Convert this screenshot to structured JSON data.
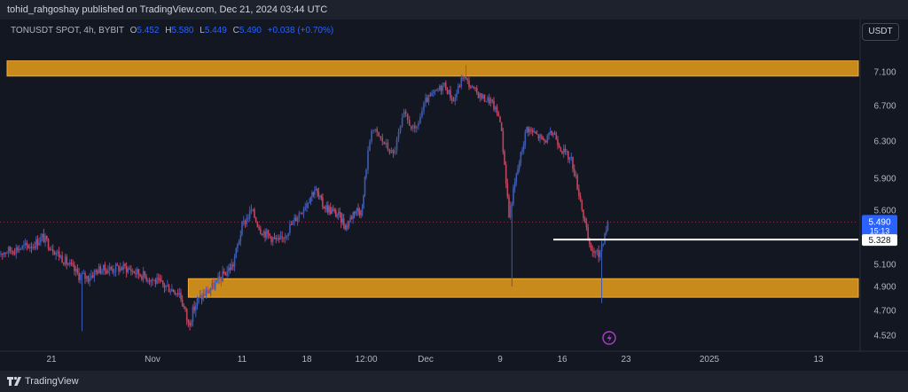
{
  "header": {
    "publisher_line": "tohid_rahgoshay published on TradingView.com, Dec 21, 2024 03:44 UTC"
  },
  "legend": {
    "symbol": "TONUSDT SPOT, 4h, BYBIT",
    "o_label": "O",
    "o_value": "5.452",
    "h_label": "H",
    "h_value": "5.580",
    "l_label": "L",
    "l_value": "5.449",
    "c_label": "C",
    "c_value": "5.490",
    "change": "+0.038 (+0.70%)"
  },
  "currency_button": "USDT",
  "footer": {
    "brand": "TradingView"
  },
  "colors": {
    "background": "#131722",
    "up_candle": "#3d5bb5",
    "down_candle": "#c2455e",
    "zone_fill": "#c98a1c",
    "price_tag": "#2962ff",
    "level_line": "#ffffff"
  },
  "chart_data": {
    "type": "candlestick",
    "symbol": "TONUSDT",
    "timeframe": "4h",
    "ylim": [
      4.45,
      7.3
    ],
    "y_ticks": [
      "7.100",
      "6.700",
      "6.300",
      "5.900",
      "5.600",
      "5.100",
      "4.900",
      "4.700",
      "4.520"
    ],
    "x_ticks": [
      "21",
      "Nov",
      "11",
      "18",
      "12:00",
      "Dec",
      "9",
      "16",
      "23",
      "2025",
      "13"
    ],
    "x_tick_dates": [
      "2024-10-21",
      "2024-11-01",
      "2024-11-11",
      "2024-11-18",
      "2024-11-25 12:00",
      "2024-12-01",
      "2024-12-09",
      "2024-12-16",
      "2024-12-23",
      "2025-01-01",
      "2025-01-13"
    ],
    "last_date": "2024-12-21",
    "current_price": {
      "value": "5.490",
      "countdown": "15:13"
    },
    "horizontal_level": {
      "value": "5.328"
    },
    "zones": [
      {
        "from": 7.05,
        "to": 7.23
      },
      {
        "from": 4.81,
        "to": 4.97
      }
    ],
    "close_path": [
      [
        "2024-10-15",
        5.2
      ],
      [
        "2024-10-17",
        5.24
      ],
      [
        "2024-10-19",
        5.28
      ],
      [
        "2024-10-20",
        5.35
      ],
      [
        "2024-10-22",
        5.17
      ],
      [
        "2024-10-24",
        5.0
      ],
      [
        "2024-10-25",
        4.98
      ],
      [
        "2024-10-26",
        5.05
      ],
      [
        "2024-10-29",
        5.07
      ],
      [
        "2024-10-31",
        5.0
      ],
      [
        "2024-11-02",
        4.92
      ],
      [
        "2024-11-04",
        4.85
      ],
      [
        "2024-11-05",
        4.6
      ],
      [
        "2024-11-06",
        4.78
      ],
      [
        "2024-11-08",
        4.92
      ],
      [
        "2024-11-10",
        5.1
      ],
      [
        "2024-11-11",
        5.45
      ],
      [
        "2024-11-12",
        5.6
      ],
      [
        "2024-11-13",
        5.42
      ],
      [
        "2024-11-15",
        5.3
      ],
      [
        "2024-11-17",
        5.55
      ],
      [
        "2024-11-19",
        5.8
      ],
      [
        "2024-11-20",
        5.65
      ],
      [
        "2024-11-22",
        5.55
      ],
      [
        "2024-11-23",
        5.45
      ],
      [
        "2024-11-24",
        5.6
      ],
      [
        "2024-11-25",
        5.6
      ],
      [
        "2024-11-26",
        6.45
      ],
      [
        "2024-11-28",
        6.15
      ],
      [
        "2024-11-29",
        6.6
      ],
      [
        "2024-11-30",
        6.4
      ],
      [
        "2024-12-01",
        6.75
      ],
      [
        "2024-12-03",
        6.95
      ],
      [
        "2024-12-04",
        6.75
      ],
      [
        "2024-12-05",
        7.05
      ],
      [
        "2024-12-06",
        6.9
      ],
      [
        "2024-12-07",
        6.8
      ],
      [
        "2024-12-08",
        6.75
      ],
      [
        "2024-12-09",
        6.55
      ],
      [
        "2024-12-10",
        5.55
      ],
      [
        "2024-12-11",
        6.0
      ],
      [
        "2024-12-12",
        6.45
      ],
      [
        "2024-12-14",
        6.3
      ],
      [
        "2024-12-15",
        6.4
      ],
      [
        "2024-12-16",
        6.2
      ],
      [
        "2024-12-17",
        6.1
      ],
      [
        "2024-12-18",
        5.7
      ],
      [
        "2024-12-19",
        5.25
      ],
      [
        "2024-12-20",
        5.18
      ],
      [
        "2024-12-21",
        5.49
      ]
    ],
    "wick_events": [
      {
        "date": "2024-10-24",
        "low": 4.55
      },
      {
        "date": "2024-11-05",
        "low": 4.58
      },
      {
        "date": "2024-12-05",
        "high": 7.18
      },
      {
        "date": "2024-12-10",
        "low": 4.9
      },
      {
        "date": "2024-12-20",
        "low": 4.76
      }
    ]
  }
}
